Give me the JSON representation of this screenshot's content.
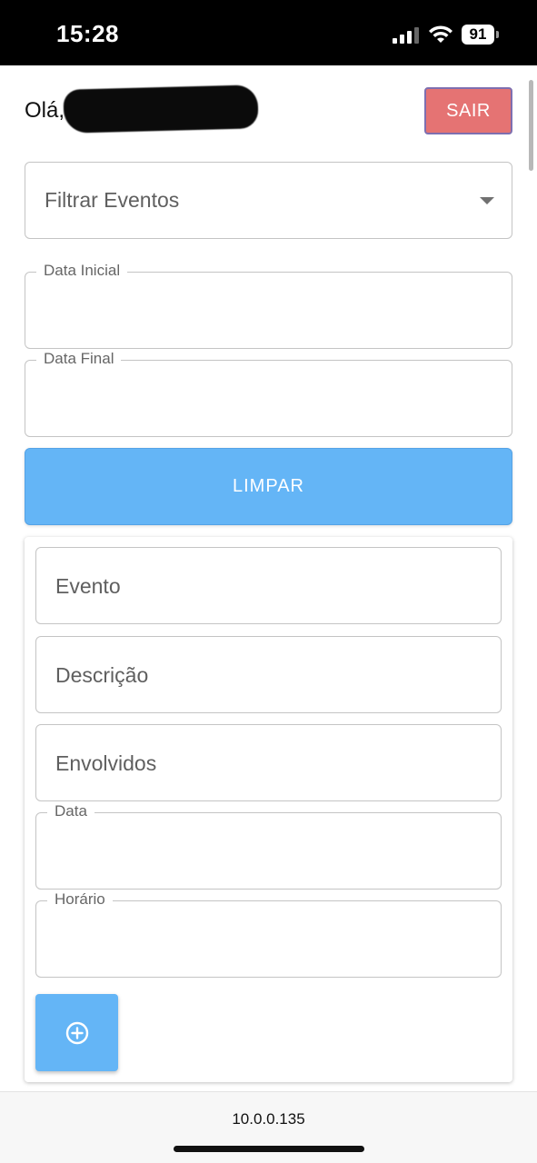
{
  "status_bar": {
    "time": "15:28",
    "battery": "91"
  },
  "header": {
    "greeting": "Olá,",
    "logout_label": "SAIR"
  },
  "filter": {
    "placeholder": "Filtrar Eventos"
  },
  "dates": {
    "start_label": "Data Inicial",
    "end_label": "Data Final"
  },
  "clear_label": "LIMPAR",
  "form": {
    "event_placeholder": "Evento",
    "description_placeholder": "Descrição",
    "involved_placeholder": "Envolvidos",
    "date_label": "Data",
    "time_label": "Horário"
  },
  "footer": {
    "url": "10.0.0.135"
  },
  "colors": {
    "primary": "#64b5f6",
    "danger": "#e57373",
    "border": "#c4c4c4"
  }
}
